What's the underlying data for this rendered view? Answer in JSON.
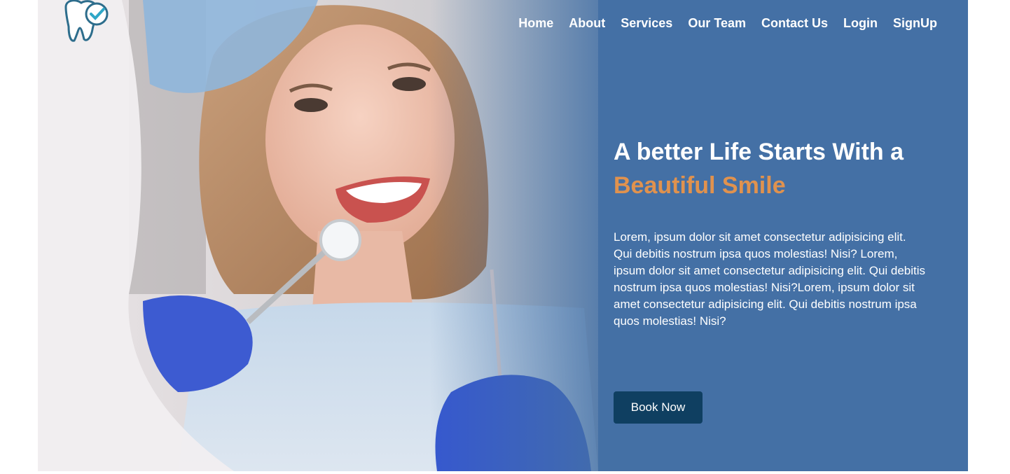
{
  "brand": {
    "logo_icon": "tooth-check-icon"
  },
  "nav": {
    "items": [
      {
        "label": "Home"
      },
      {
        "label": "About"
      },
      {
        "label": "Services"
      },
      {
        "label": "Our Team"
      },
      {
        "label": "Contact Us"
      },
      {
        "label": "Login"
      },
      {
        "label": "SignUp"
      }
    ]
  },
  "hero": {
    "headline": "A better Life Starts With a",
    "headline_accent": "Beautiful Smile",
    "description": "Lorem, ipsum dolor sit amet consectetur adipisicing elit. Qui debitis nostrum ipsa quos molestias! Nisi? Lorem, ipsum dolor sit amet consectetur adipisicing elit. Qui debitis nostrum ipsa quos molestias! Nisi?Lorem, ipsum dolor sit amet consectetur adipisicing elit. Qui debitis nostrum ipsa quos molestias! Nisi?",
    "cta_label": "Book Now"
  },
  "colors": {
    "hero_background": "#4470a5",
    "accent": "#e0924e",
    "button": "#0f3f61",
    "text": "#ffffff"
  }
}
